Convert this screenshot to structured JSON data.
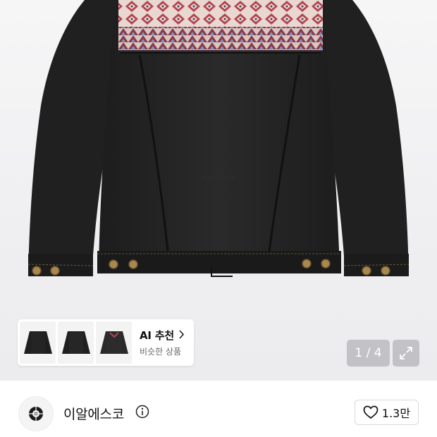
{
  "product_image": {
    "watermark": "musinsa",
    "colors": {
      "denim": "#232323",
      "pattern_red": "#b5444f",
      "pattern_blue": "#7f96c7",
      "button": "#a8884f"
    }
  },
  "ai_recommend": {
    "title": "AI 추천",
    "subtitle": "비슷한 상품",
    "chevron_icon": "chevron-right-icon",
    "thumbnails": [
      "black-jacket-thumb",
      "black-jacket-thumb",
      "black-denim-jacket-thumb"
    ]
  },
  "gallery": {
    "counter": "1 / 4",
    "expand_icon": "expand-icon"
  },
  "seller": {
    "name": "이알에스코",
    "info_icon": "info-icon",
    "like_icon": "heart-icon",
    "like_count": "1.3만"
  }
}
